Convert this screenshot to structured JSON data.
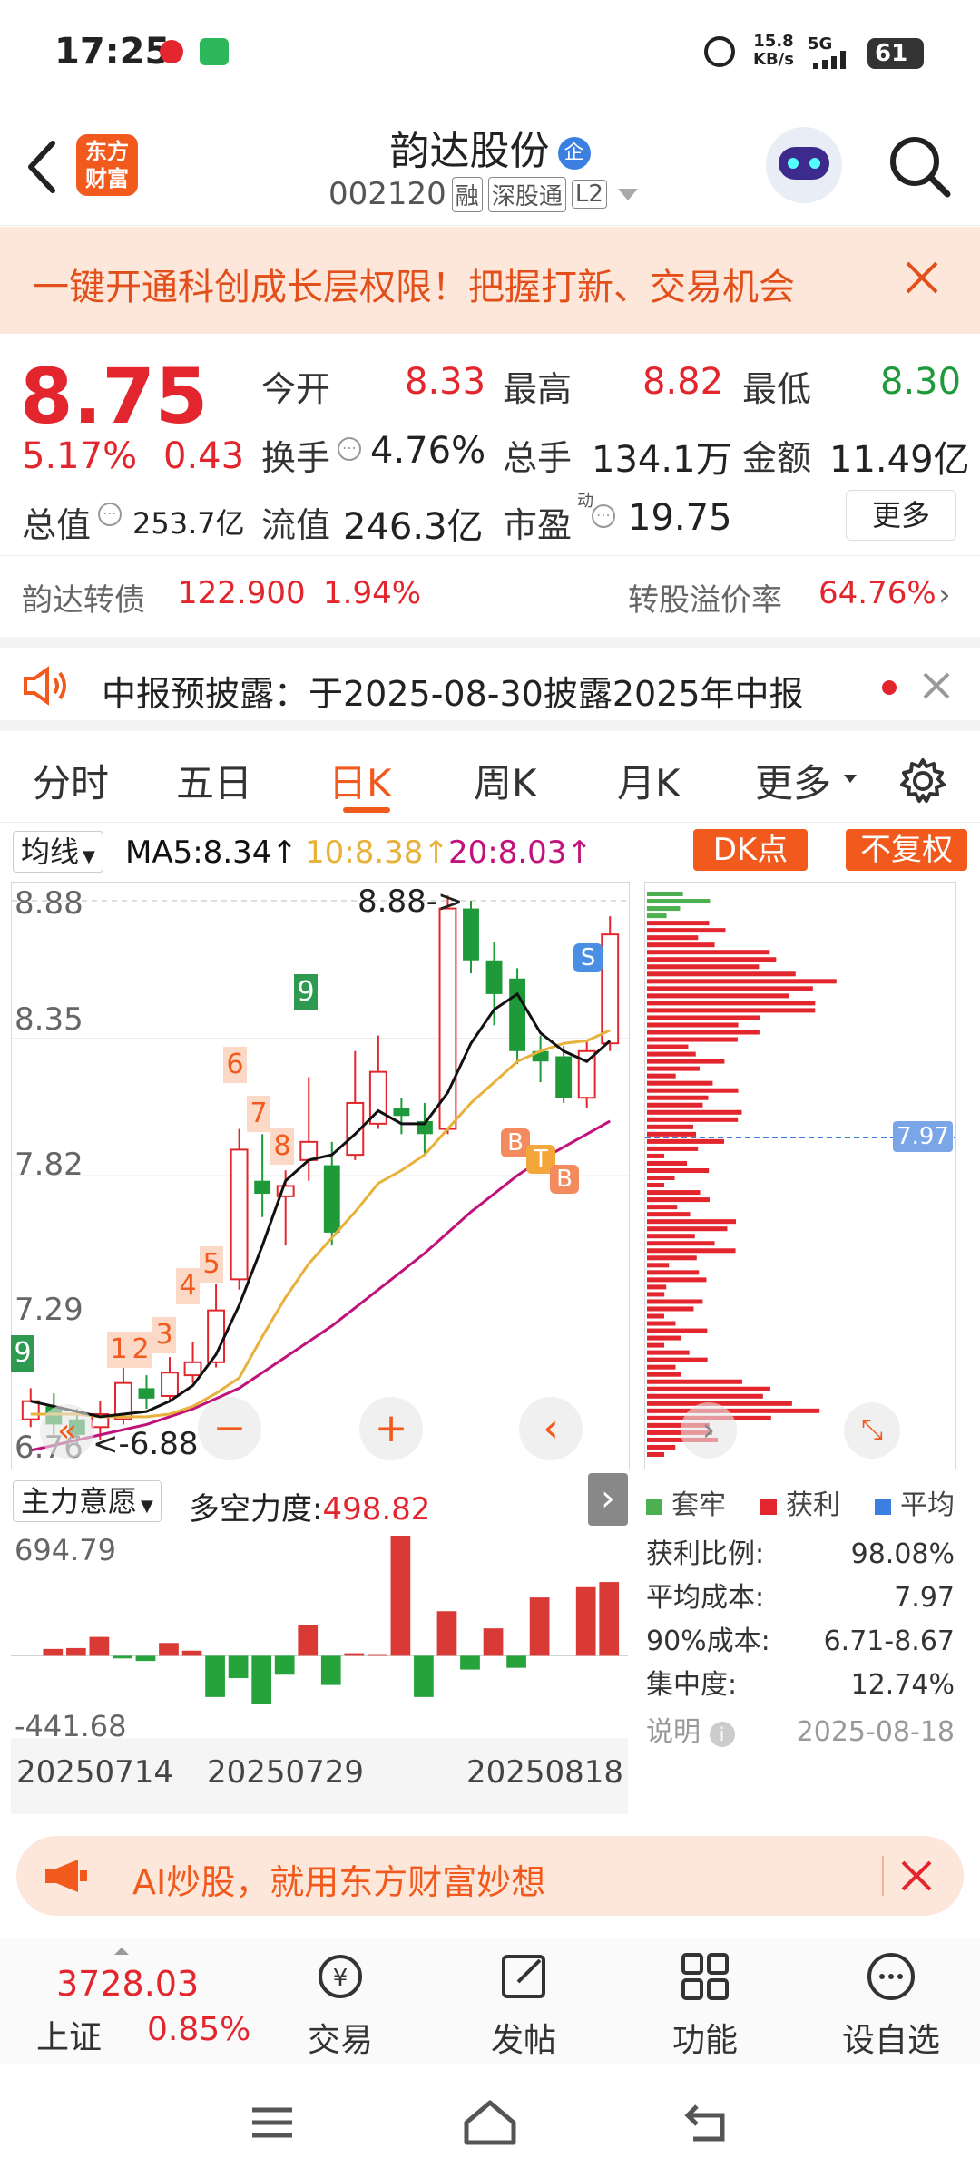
{
  "status_bar": {
    "time": "17:25",
    "net_speed_top": "15.8",
    "net_speed_bottom": "KB/s",
    "signal": "5G",
    "battery": "61"
  },
  "header": {
    "title": "韵达股份",
    "title_badge": "企",
    "code": "002120",
    "tags": [
      "融",
      "深股通",
      "L2"
    ],
    "logo_line1": "东方",
    "logo_line2": "财富"
  },
  "banner": {
    "text": "一键开通科创成长层权限！把握打新、交易机会"
  },
  "quote": {
    "price": "8.75",
    "change_pct": "5.17%",
    "change_abs": "0.43",
    "open_label": "今开",
    "open": "8.33",
    "high_label": "最高",
    "high": "8.82",
    "low_label": "最低",
    "low": "8.30",
    "turnover_label": "换手",
    "turnover": "4.76%",
    "volume_label": "总手",
    "volume": "134.1万",
    "amount_label": "金额",
    "amount": "11.49亿",
    "mktcap_label": "总值",
    "mktcap": "253.7亿",
    "float_label": "流值",
    "float": "246.3亿",
    "pe_label": "市盈",
    "pe_sup": "动",
    "pe": "19.75",
    "more_label": "更多"
  },
  "bond": {
    "name": "韵达转债",
    "price": "122.900",
    "change": "1.94%",
    "premium_label": "转股溢价率",
    "premium": "64.76%"
  },
  "notice": {
    "text": "中报预披露：于2025-08-30披露2025年中报"
  },
  "tabs": [
    "分时",
    "五日",
    "日K",
    "周K",
    "月K",
    "更多"
  ],
  "active_tab": "日K",
  "chart_header": {
    "indicator_select": "均线",
    "ma5": "MA5:8.34",
    "ma10": "10:8.38",
    "ma20": "20:8.03",
    "dk_button": "DK点",
    "fq_button": "不复权"
  },
  "kline": {
    "y_labels": [
      "8.88",
      "8.35",
      "7.82",
      "7.29",
      "6.76"
    ],
    "max_label": "8.88->",
    "min_label": "<-6.88",
    "markers": [
      "9",
      "1",
      "2",
      "3",
      "4",
      "5",
      "6",
      "7",
      "8",
      "9"
    ],
    "signals": [
      "S",
      "B",
      "T",
      "B"
    ]
  },
  "chip_panel": {
    "avg_label": "7.97",
    "legend": [
      "套牢",
      "获利",
      "平均"
    ],
    "rows": [
      {
        "label": "获利比例:",
        "value": "98.08%"
      },
      {
        "label": "平均成本:",
        "value": "7.97"
      },
      {
        "label": "90%成本:",
        "value": "6.71-8.67"
      },
      {
        "label": "集中度:",
        "value": "12.74%"
      }
    ],
    "note_label": "说明",
    "date": "2025-08-18"
  },
  "sub_chart": {
    "indicator_select": "主力意愿",
    "metric_label": "多空力度:",
    "metric_value": "498.82",
    "y_top": "694.79",
    "y_bottom": "-441.68",
    "x_labels": [
      "20250714",
      "20250729",
      "20250818"
    ]
  },
  "ad_bar": {
    "text": "AI炒股，就用东方财富妙想"
  },
  "bottom_nav": {
    "index_value": "3728.03",
    "index_name": "上证",
    "index_change": "0.85%",
    "items": [
      "交易",
      "发帖",
      "功能",
      "设自选"
    ]
  },
  "colors": {
    "up": "#e3262d",
    "down": "#1e9a3a",
    "ma5": "#111111",
    "ma10": "#e8b13a",
    "ma20": "#c0127a",
    "brand": "#f25a1d"
  },
  "chart_data": {
    "type": "candlestick",
    "ylim": [
      6.76,
      8.88
    ],
    "candles": [
      {
        "o": 6.88,
        "c": 6.95,
        "h": 7.0,
        "l": 6.85
      },
      {
        "o": 6.93,
        "c": 6.86,
        "h": 6.98,
        "l": 6.82
      },
      {
        "o": 6.88,
        "c": 6.82,
        "h": 6.92,
        "l": 6.78
      },
      {
        "o": 6.85,
        "c": 6.9,
        "h": 6.95,
        "l": 6.8
      },
      {
        "o": 6.88,
        "c": 7.02,
        "h": 7.08,
        "l": 6.86
      },
      {
        "o": 7.0,
        "c": 6.96,
        "h": 7.05,
        "l": 6.92
      },
      {
        "o": 6.97,
        "c": 7.06,
        "h": 7.12,
        "l": 6.95
      },
      {
        "o": 7.05,
        "c": 7.1,
        "h": 7.18,
        "l": 7.02
      },
      {
        "o": 7.1,
        "c": 7.3,
        "h": 7.4,
        "l": 7.08
      },
      {
        "o": 7.42,
        "c": 7.92,
        "h": 8.0,
        "l": 7.38
      },
      {
        "o": 7.8,
        "c": 7.75,
        "h": 7.98,
        "l": 7.66
      },
      {
        "o": 7.74,
        "c": 7.78,
        "h": 7.84,
        "l": 7.55
      },
      {
        "o": 7.88,
        "c": 7.95,
        "h": 8.2,
        "l": 7.8
      },
      {
        "o": 7.86,
        "c": 7.6,
        "h": 7.95,
        "l": 7.55
      },
      {
        "o": 7.9,
        "c": 8.1,
        "h": 8.3,
        "l": 7.88
      },
      {
        "o": 8.02,
        "c": 8.22,
        "h": 8.36,
        "l": 8.0
      },
      {
        "o": 8.08,
        "c": 8.05,
        "h": 8.12,
        "l": 7.98
      },
      {
        "o": 8.03,
        "c": 7.98,
        "h": 8.1,
        "l": 7.9
      },
      {
        "o": 8.0,
        "c": 8.85,
        "h": 8.9,
        "l": 7.98
      },
      {
        "o": 8.85,
        "c": 8.65,
        "h": 8.88,
        "l": 8.6
      },
      {
        "o": 8.65,
        "c": 8.52,
        "h": 8.72,
        "l": 8.4
      },
      {
        "o": 8.58,
        "c": 8.3,
        "h": 8.62,
        "l": 8.25
      },
      {
        "o": 8.3,
        "c": 8.26,
        "h": 8.36,
        "l": 8.18
      },
      {
        "o": 8.28,
        "c": 8.12,
        "h": 8.32,
        "l": 8.1
      },
      {
        "o": 8.12,
        "c": 8.3,
        "h": 8.34,
        "l": 8.08
      },
      {
        "o": 8.33,
        "c": 8.75,
        "h": 8.82,
        "l": 8.3
      }
    ],
    "ma5": [
      6.95,
      6.93,
      6.91,
      6.89,
      6.9,
      6.91,
      6.95,
      7.01,
      7.13,
      7.32,
      7.55,
      7.8,
      7.88,
      7.9,
      7.98,
      8.07,
      8.02,
      8.02,
      8.14,
      8.33,
      8.46,
      8.52,
      8.37,
      8.3,
      8.26,
      8.34
    ],
    "ma10": [
      6.9,
      6.9,
      6.9,
      6.89,
      6.89,
      6.89,
      6.9,
      6.93,
      6.98,
      7.04,
      7.2,
      7.35,
      7.48,
      7.58,
      7.68,
      7.79,
      7.84,
      7.9,
      8.0,
      8.1,
      8.18,
      8.26,
      8.3,
      8.33,
      8.34,
      8.38
    ],
    "ma20": [
      6.76,
      6.78,
      6.8,
      6.82,
      6.84,
      6.86,
      6.89,
      6.92,
      6.96,
      7.0,
      7.06,
      7.12,
      7.18,
      7.24,
      7.31,
      7.38,
      7.45,
      7.52,
      7.6,
      7.68,
      7.75,
      7.82,
      7.88,
      7.93,
      7.98,
      8.03
    ],
    "sub_values": [
      0,
      40,
      45,
      110,
      -15,
      -30,
      75,
      30,
      -240,
      -130,
      -280,
      -110,
      180,
      -170,
      15,
      10,
      700,
      -240,
      260,
      -80,
      160,
      -70,
      340,
      0,
      400,
      430
    ]
  }
}
